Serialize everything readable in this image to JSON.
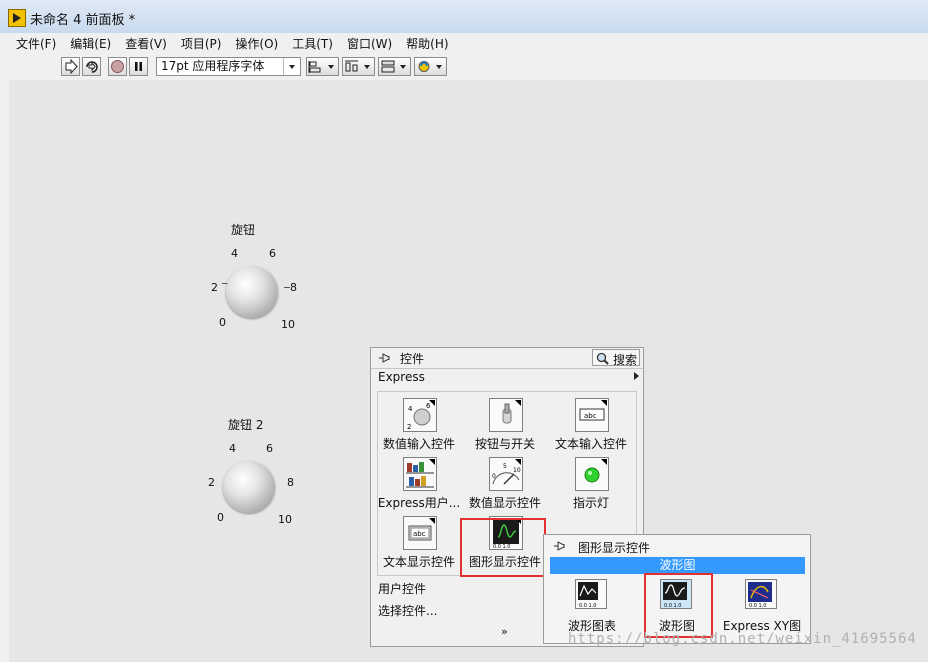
{
  "window": {
    "title": "未命名 4 前面板 *"
  },
  "menu": [
    "文件(F)",
    "编辑(E)",
    "查看(V)",
    "项目(P)",
    "操作(O)",
    "工具(T)",
    "窗口(W)",
    "帮助(H)"
  ],
  "toolbar": {
    "font": "17pt 应用程序字体"
  },
  "knob1": {
    "label": "旋钮",
    "ticks": [
      "0",
      "2",
      "4",
      "6",
      "8",
      "10"
    ]
  },
  "knob2": {
    "label": "旋钮 2",
    "ticks": [
      "0",
      "2",
      "4",
      "6",
      "8",
      "10"
    ]
  },
  "palette": {
    "title": "控件",
    "search": "搜索",
    "category": "Express",
    "items": [
      "数值输入控件",
      "按钮与开关",
      "文本输入控件",
      "Express用户...",
      "数值显示控件",
      "指示灯",
      "文本显示控件",
      "图形显示控件"
    ],
    "links": [
      "用户控件",
      "选择控件..."
    ],
    "more": "»"
  },
  "subpalette": {
    "title": "图形显示控件",
    "highlight": "波形图",
    "items": [
      "波形图表",
      "波形图",
      "Express XY图"
    ]
  },
  "watermark": "https://blog.csdn.net/weixin_41695564",
  "colors": {
    "highlight": "#3399ff",
    "annotation_box": "#e33030",
    "panel": "#e6e6e6"
  }
}
